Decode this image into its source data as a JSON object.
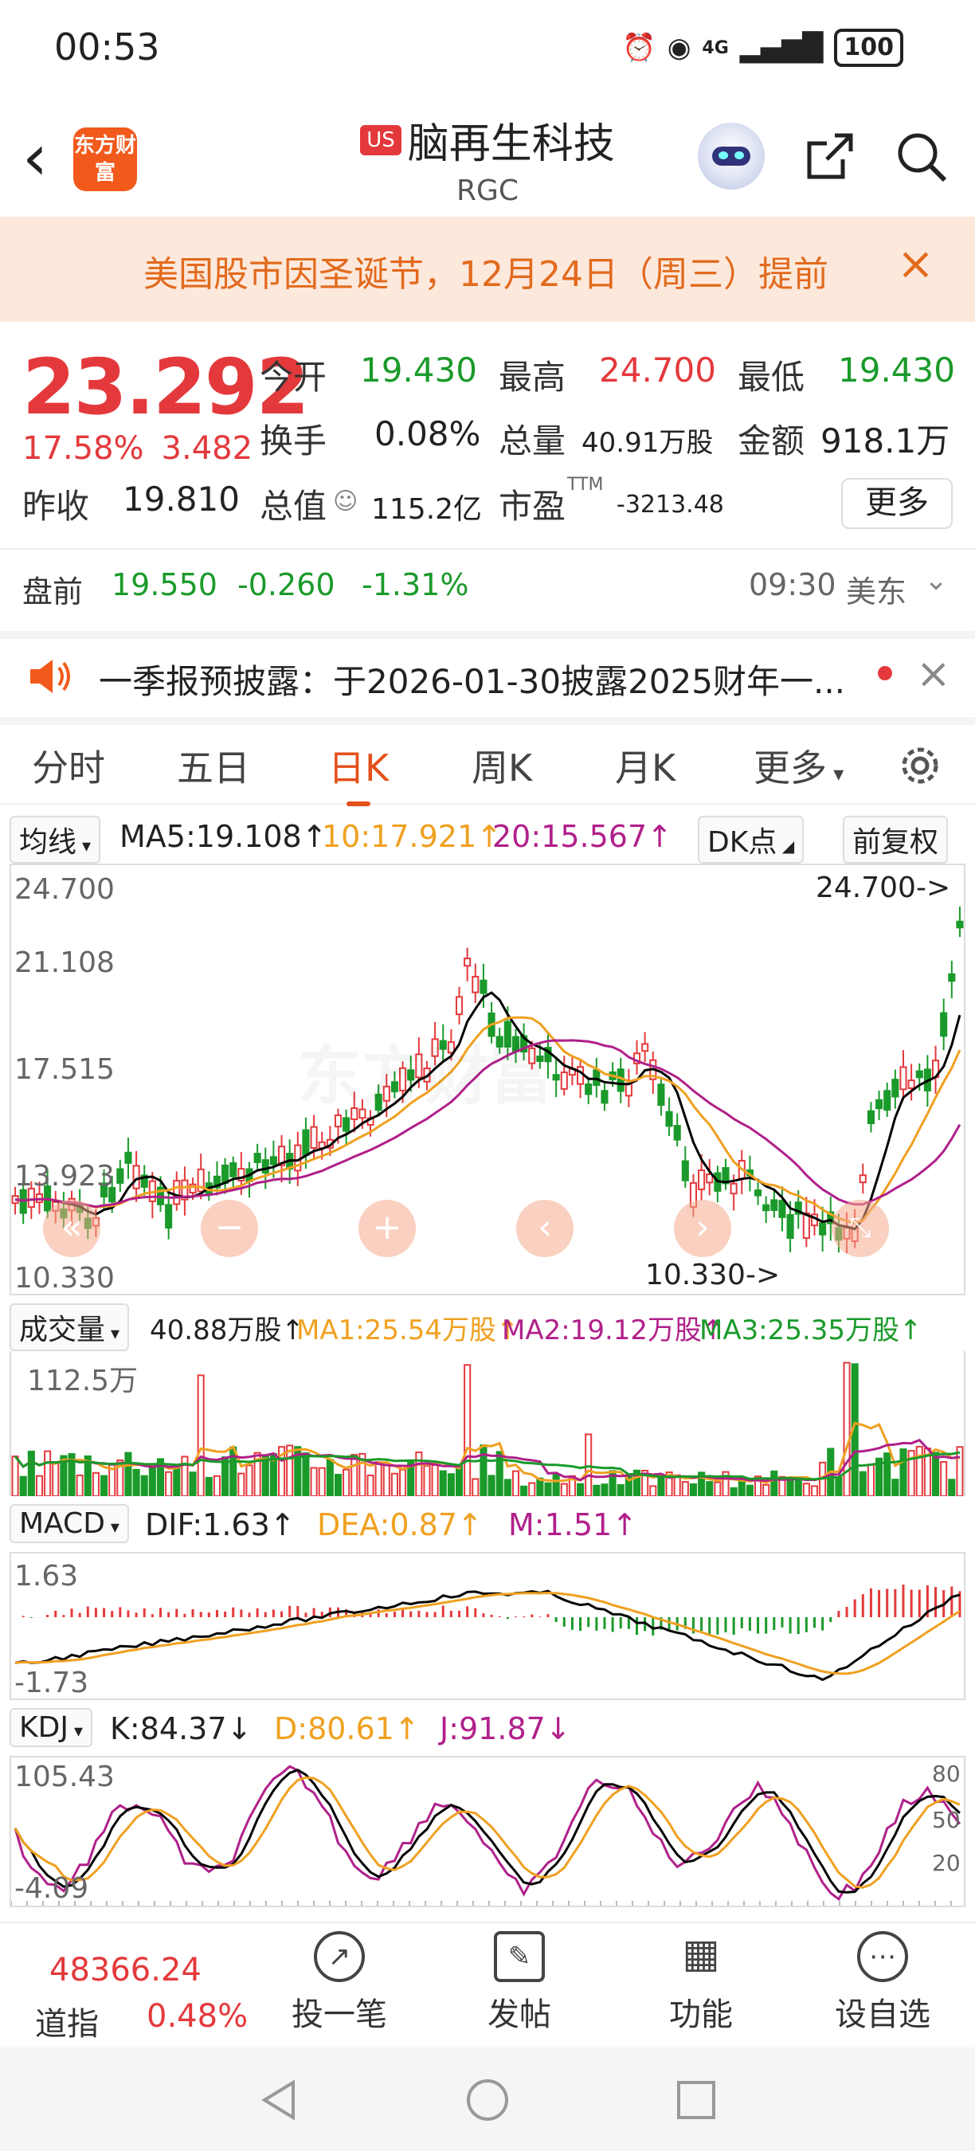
{
  "status": {
    "time": "00:53",
    "battery": "100",
    "net": "4G"
  },
  "header": {
    "market_tag": "US",
    "name": "脑再生科技",
    "code": "RGC",
    "logo_text": "东方财富"
  },
  "notice": {
    "text": "美国股市因圣诞节，12月24日（周三）提前",
    "close": "×"
  },
  "quote": {
    "price": "23.292",
    "pct": "17.58%",
    "chg": "3.482",
    "open_label": "今开",
    "open": "19.430",
    "high_label": "最高",
    "high": "24.700",
    "low_label": "最低",
    "low": "19.430",
    "turnover_label": "换手",
    "turnover": "0.08%",
    "volume_label": "总量",
    "volume": "40.91万股",
    "amount_label": "金额",
    "amount": "918.1万",
    "prev_label": "昨收",
    "prev": "19.810",
    "cap_label": "总值",
    "cap": "115.2亿",
    "pe_label": "市盈",
    "pe_sup": "TTM",
    "pe": "-3213.48",
    "more": "更多"
  },
  "premarket": {
    "label": "盘前",
    "price": "19.550",
    "chg": "-0.260",
    "pct": "-1.31%",
    "time": "09:30",
    "zone": "美东"
  },
  "announcement": {
    "text": "一季报预披露：于2026-01-30披露2025财年一..."
  },
  "tabs": [
    "分时",
    "五日",
    "日K",
    "周K",
    "月K",
    "更多"
  ],
  "ma_row": {
    "selector": "均线",
    "ma5": "MA5:19.108↑",
    "ma10": "10:17.921↑",
    "ma20": "20:15.567↑",
    "dk": "DK点",
    "adj": "前复权"
  },
  "kline": {
    "y_ticks": [
      "24.700",
      "21.108",
      "17.515",
      "13.923",
      "10.330"
    ],
    "max_label": "24.700->",
    "min_label": "10.330->"
  },
  "vol_row": {
    "selector": "成交量",
    "v": "40.88万股↑",
    "ma1": "MA1:25.54万股↑",
    "ma2": "MA2:19.12万股↑",
    "ma3": "MA3:25.35万股↑",
    "y_top": "112.5万"
  },
  "macd_row": {
    "selector": "MACD",
    "dif": "DIF:1.63↑",
    "dea": "DEA:0.87↑",
    "m": "M:1.51↑",
    "y_top": "1.63",
    "y_bot": "-1.73"
  },
  "kdj_row": {
    "selector": "KDJ",
    "k": "K:84.37↓",
    "d": "D:80.61↑",
    "j": "J:91.87↓",
    "y_top": "105.43",
    "y_bot": "-4.09",
    "r80": "80",
    "r50": "50",
    "r20": "20"
  },
  "bottom": {
    "index_val": "48366.24",
    "index_name": "道指",
    "index_pct": "0.48%",
    "nav": [
      "投一笔",
      "发帖",
      "功能",
      "设自选"
    ]
  },
  "colors": {
    "up": "#e4393c",
    "down": "#1a9a2a",
    "ma5": "#000000",
    "ma10": "#f0a020",
    "ma20": "#b0208a",
    "accent": "#e4501c"
  }
}
